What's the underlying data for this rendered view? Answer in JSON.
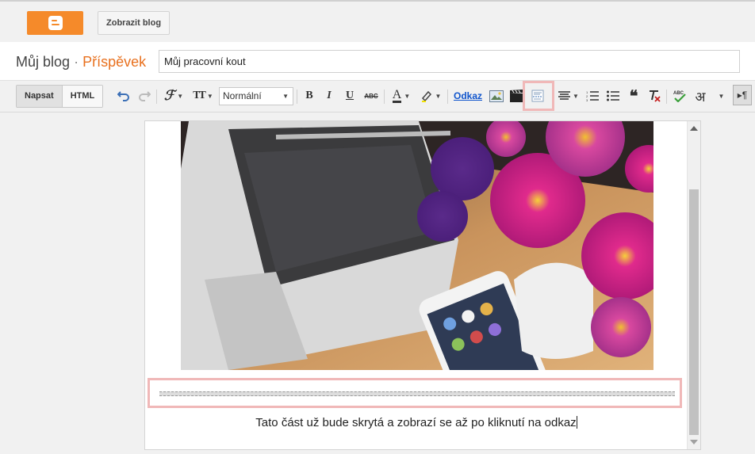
{
  "topbar": {
    "logo_icon": "blogger-logo-icon",
    "view_blog_label": "Zobrazit blog"
  },
  "titlebar": {
    "blog_name": "Můj blog",
    "separator": "·",
    "section": "Příspěvek",
    "post_title_value": "Můj pracovní kout"
  },
  "toolbar": {
    "compose_label": "Napsat",
    "html_label": "HTML",
    "font_size_label": "TT",
    "format_value": "Normální",
    "bold_label": "B",
    "italic_label": "I",
    "underline_label": "U",
    "strike_label": "ABC",
    "text_color_label": "A",
    "link_label": "Odkaz",
    "hindi_label": "अ",
    "pilcrow_label": "▸¶",
    "accent_color": "#f58a2a",
    "highlight_color": "#f0b8b8"
  },
  "editor": {
    "image_alt": "laptop-phone-flowers-photo",
    "jump_break_icon": "read-more-break",
    "body_text": "Tato část už bude skrytá a zobrazí se až po kliknutí na odkaz"
  }
}
